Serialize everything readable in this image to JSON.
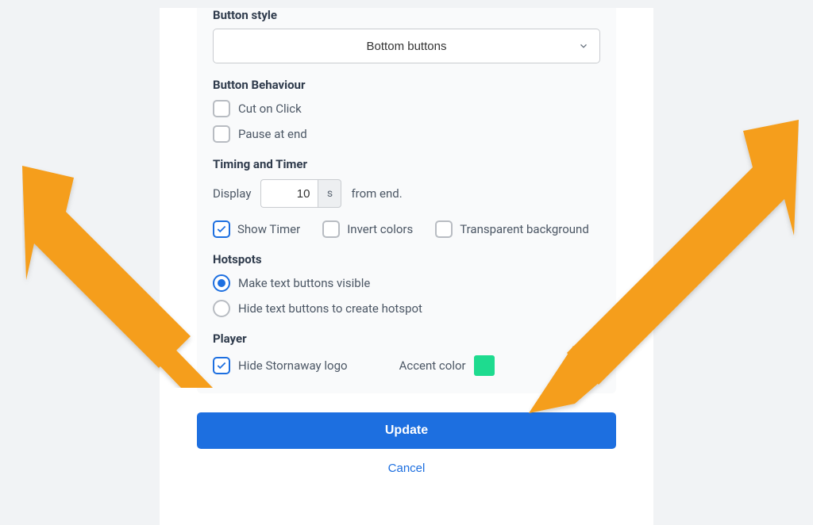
{
  "buttonStyle": {
    "label": "Button style",
    "selected": "Bottom buttons"
  },
  "buttonBehaviour": {
    "label": "Button Behaviour",
    "cutOnClick": {
      "label": "Cut on Click",
      "checked": false
    },
    "pauseAtEnd": {
      "label": "Pause at end",
      "checked": false
    }
  },
  "timing": {
    "label": "Timing and Timer",
    "displayWord": "Display",
    "value": "10",
    "unit": "s",
    "fromEnd": "from end.",
    "showTimer": {
      "label": "Show Timer",
      "checked": true
    },
    "invertColors": {
      "label": "Invert colors",
      "checked": false
    },
    "transparentBg": {
      "label": "Transparent background",
      "checked": false
    }
  },
  "hotspots": {
    "label": "Hotspots",
    "visible": {
      "label": "Make text buttons visible",
      "selected": true
    },
    "hide": {
      "label": "Hide text buttons to create hotspot",
      "selected": false
    }
  },
  "player": {
    "label": "Player",
    "hideLogo": {
      "label": "Hide Stornaway logo",
      "checked": true
    },
    "accentLabel": "Accent color",
    "accentColor": "#1edb8f"
  },
  "actions": {
    "update": "Update",
    "cancel": "Cancel"
  }
}
